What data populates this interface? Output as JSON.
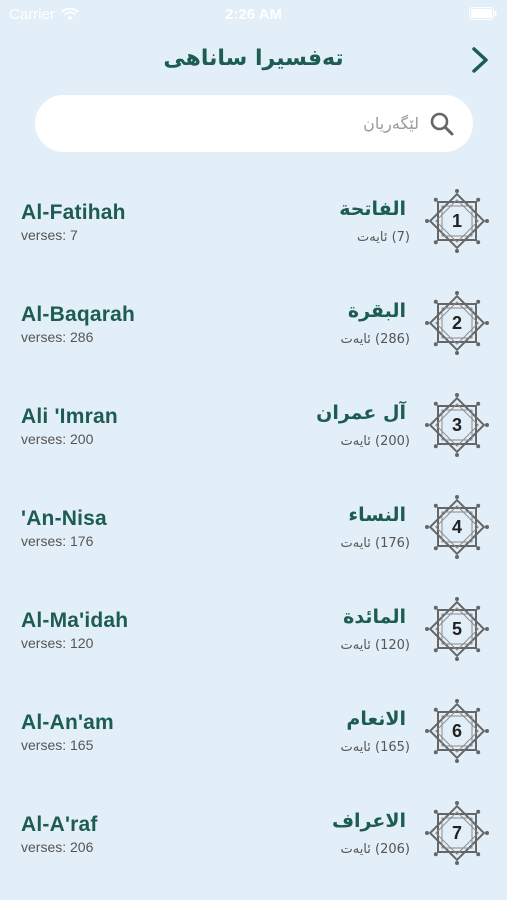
{
  "status": {
    "carrier": "Carrier",
    "time": "2:26 AM"
  },
  "nav": {
    "title": "تەفسیرا ساناهی"
  },
  "search": {
    "placeholder": "لێگەریان"
  },
  "surahs": [
    {
      "number": "1",
      "en_name": "Al-Fatihah",
      "en_verses": "verses: 7",
      "ar_name": "الفاتحة",
      "ar_verses": "(7) ئایەت"
    },
    {
      "number": "2",
      "en_name": "Al-Baqarah",
      "en_verses": "verses: 286",
      "ar_name": "البقرة",
      "ar_verses": "(286) ئایەت"
    },
    {
      "number": "3",
      "en_name": "Ali 'Imran",
      "en_verses": "verses: 200",
      "ar_name": "آل عمران",
      "ar_verses": "(200) ئایەت"
    },
    {
      "number": "4",
      "en_name": "'An-Nisa",
      "en_verses": "verses: 176",
      "ar_name": "النساء",
      "ar_verses": "(176) ئایەت"
    },
    {
      "number": "5",
      "en_name": "Al-Ma'idah",
      "en_verses": "verses: 120",
      "ar_name": "المائدة",
      "ar_verses": "(120) ئایەت"
    },
    {
      "number": "6",
      "en_name": "Al-An'am",
      "en_verses": "verses: 165",
      "ar_name": "الانعام",
      "ar_verses": "(165) ئایەت"
    },
    {
      "number": "7",
      "en_name": "Al-A'raf",
      "en_verses": "verses: 206",
      "ar_name": "الاعراف",
      "ar_verses": "(206) ئایەت"
    }
  ],
  "colors": {
    "background": "#e3eff8",
    "accent": "#1d5c52",
    "badge_ornament": "#666666"
  },
  "icons": {
    "back": "chevron-right-icon",
    "search": "search-icon",
    "badge": "star-ornament-icon",
    "wifi": "wifi-icon",
    "battery": "battery-icon"
  }
}
